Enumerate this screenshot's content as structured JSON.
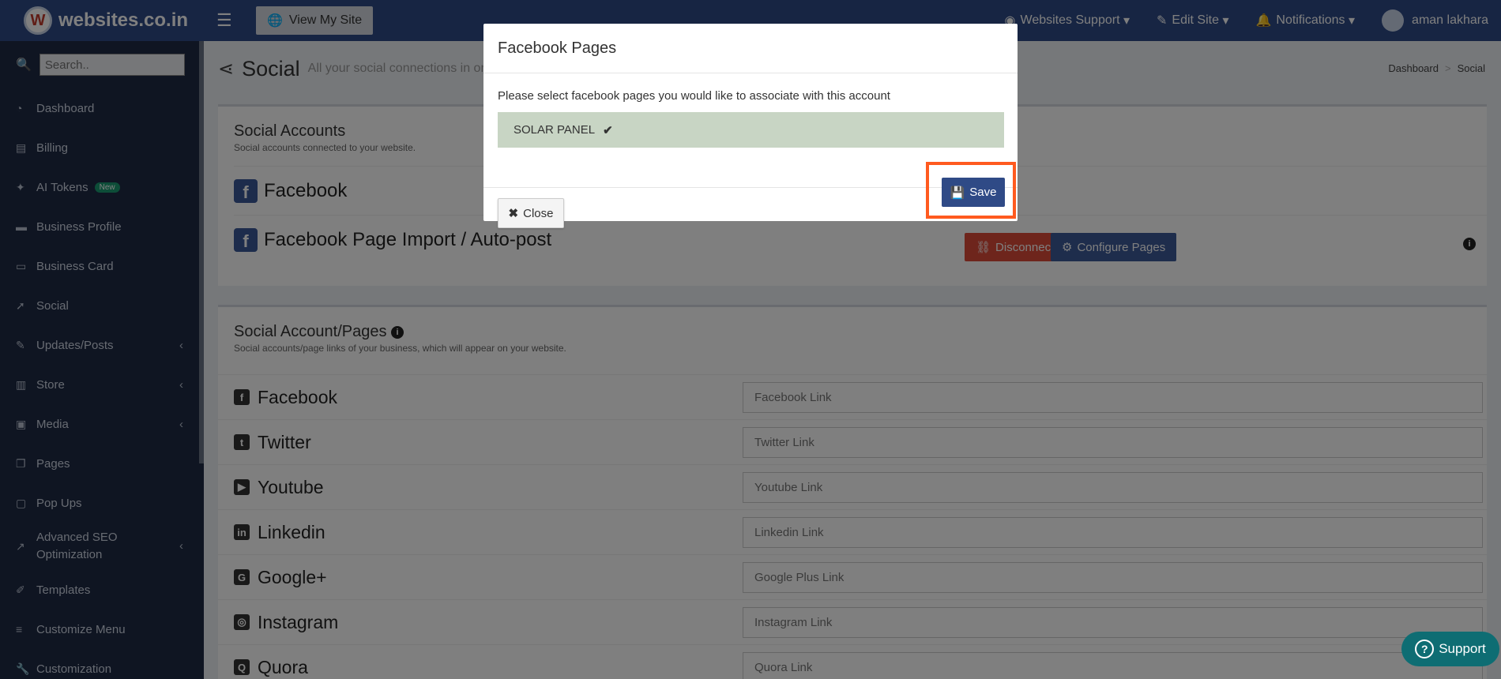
{
  "brand": {
    "name": "websites.co.in",
    "logo_letter": "W"
  },
  "topbar": {
    "view_site": "View My Site",
    "support": "Websites Support",
    "edit_site": "Edit Site",
    "notifications": "Notifications",
    "user": "aman lakhara"
  },
  "sidebar": {
    "search_placeholder": "Search..",
    "items": [
      {
        "label": "Dashboard",
        "icon": "dashboard-icon"
      },
      {
        "label": "Billing",
        "icon": "file-icon"
      },
      {
        "label": "AI Tokens",
        "icon": "magic-wand-icon",
        "badge": "New"
      },
      {
        "label": "Business Profile",
        "icon": "briefcase-icon"
      },
      {
        "label": "Business Card",
        "icon": "card-icon"
      },
      {
        "label": "Social",
        "icon": "rocket-icon"
      },
      {
        "label": "Updates/Posts",
        "icon": "pencil-icon"
      },
      {
        "label": "Store",
        "icon": "store-icon"
      },
      {
        "label": "Media",
        "icon": "image-icon"
      },
      {
        "label": "Pages",
        "icon": "copy-icon"
      },
      {
        "label": "Pop Ups",
        "icon": "window-icon"
      },
      {
        "label": "Advanced SEO Optimization",
        "icon": "trend-icon"
      },
      {
        "label": "Templates",
        "icon": "brush-icon"
      },
      {
        "label": "Customize Menu",
        "icon": "list-icon"
      },
      {
        "label": "Customization",
        "icon": "wrench-icon"
      }
    ]
  },
  "page": {
    "title": "Social",
    "subtitle": "All your social connections in one",
    "breadcrumb": [
      "Dashboard",
      "Social"
    ]
  },
  "social_accounts": {
    "title": "Social Accounts",
    "desc": "Social accounts connected to your website.",
    "rows": [
      {
        "name": "Facebook"
      },
      {
        "name": "Facebook Page Import / Auto-post"
      }
    ],
    "disconnect": "Disconnect",
    "configure": "Configure Pages"
  },
  "social_pages": {
    "title": "Social Account/Pages",
    "desc": "Social accounts/page links of your business, which will appear on your website.",
    "links": [
      {
        "name": "Facebook",
        "placeholder": "Facebook Link",
        "glyph": "f"
      },
      {
        "name": "Twitter",
        "placeholder": "Twitter Link",
        "glyph": "t"
      },
      {
        "name": "Youtube",
        "placeholder": "Youtube Link",
        "glyph": "▶"
      },
      {
        "name": "Linkedin",
        "placeholder": "Linkedin Link",
        "glyph": "in"
      },
      {
        "name": "Google+",
        "placeholder": "Google Plus Link",
        "glyph": "G"
      },
      {
        "name": "Instagram",
        "placeholder": "Instagram Link",
        "glyph": "◎"
      },
      {
        "name": "Quora",
        "placeholder": "Quora Link",
        "glyph": "Q"
      }
    ]
  },
  "modal": {
    "title": "Facebook Pages",
    "instruction": "Please select facebook pages you would like to associate with this account",
    "selected_page": "SOLAR PANEL",
    "close": "Close",
    "save": "Save"
  },
  "support_button": "Support"
}
